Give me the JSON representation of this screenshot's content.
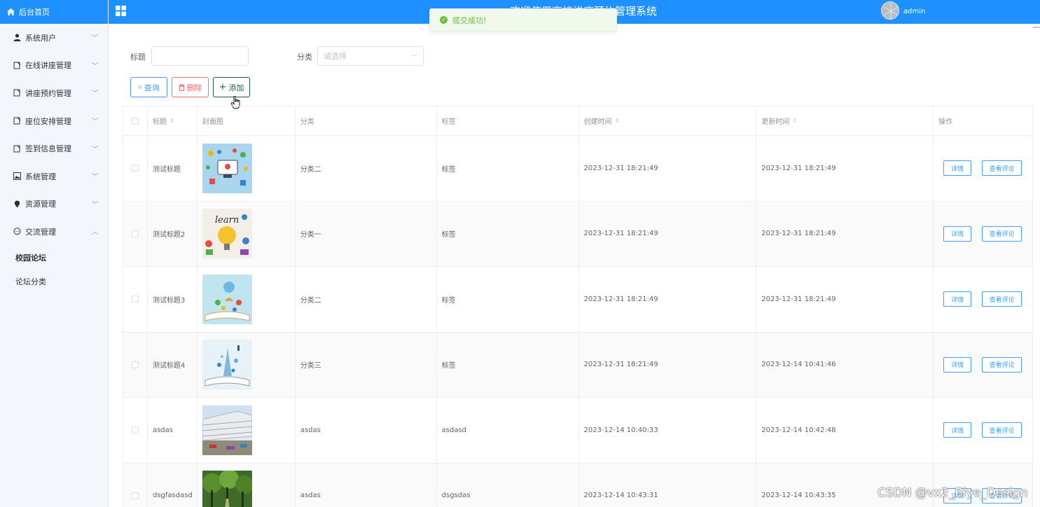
{
  "sidebar": {
    "home_label": "后台首页",
    "items": [
      {
        "label": "系统用户",
        "icon": "user-icon"
      },
      {
        "label": "在线讲座管理",
        "icon": "document-icon"
      },
      {
        "label": "讲座预约管理",
        "icon": "document-icon"
      },
      {
        "label": "座位安排管理",
        "icon": "document-icon"
      },
      {
        "label": "签到信息管理",
        "icon": "document-icon"
      },
      {
        "label": "系统管理",
        "icon": "picture-icon"
      },
      {
        "label": "资源管理",
        "icon": "location-icon"
      },
      {
        "label": "交流管理",
        "icon": "chat-icon"
      }
    ],
    "sub_items": [
      {
        "label": "校园论坛",
        "active": true
      },
      {
        "label": "论坛分类",
        "active": false
      }
    ]
  },
  "header": {
    "title": "欢迎使用高校讲座预约管理系统",
    "username": "admin"
  },
  "toast": {
    "message": "提交成功!"
  },
  "filters": {
    "title_label": "标题",
    "title_value": "",
    "category_label": "分类",
    "category_placeholder": "请选择"
  },
  "actions": {
    "query": "查询",
    "delete": "删除",
    "add": "添加"
  },
  "table": {
    "columns": [
      "标题",
      "封面图",
      "分类",
      "标签",
      "创建时间",
      "更新时间",
      "操作"
    ],
    "detail_label": "详情",
    "comments_label": "查看评论",
    "rows": [
      {
        "title": "测试标题",
        "category": "分类二",
        "tag": "标签",
        "created": "2023-12-31 18:21:49",
        "updated": "2023-12-31 18:21:49"
      },
      {
        "title": "测试标题2",
        "category": "分类一",
        "tag": "标签",
        "created": "2023-12-31 18:21:49",
        "updated": "2023-12-31 18:21:49"
      },
      {
        "title": "测试标题3",
        "category": "分类二",
        "tag": "标签",
        "created": "2023-12-31 18:21:49",
        "updated": "2023-12-31 18:21:49"
      },
      {
        "title": "测试标题4",
        "category": "分类三",
        "tag": "标签",
        "created": "2023-12-31 18:21:49",
        "updated": "2023-12-14 10:41:46"
      },
      {
        "title": "asdas",
        "category": "asdas",
        "tag": "asdasd",
        "created": "2023-12-14 10:40:33",
        "updated": "2023-12-14 10:42:48"
      },
      {
        "title": "dsgfasdasd",
        "category": "asdas",
        "tag": "dsgsdas",
        "created": "2023-12-14 10:43:31",
        "updated": "2023-12-14 10:43:35"
      }
    ]
  },
  "watermark": "CSDN @vx2_Biye_Design",
  "colors": {
    "primary": "#1e90ff",
    "success": "#67c23a",
    "danger": "#f56c6c",
    "link": "#409eff"
  }
}
